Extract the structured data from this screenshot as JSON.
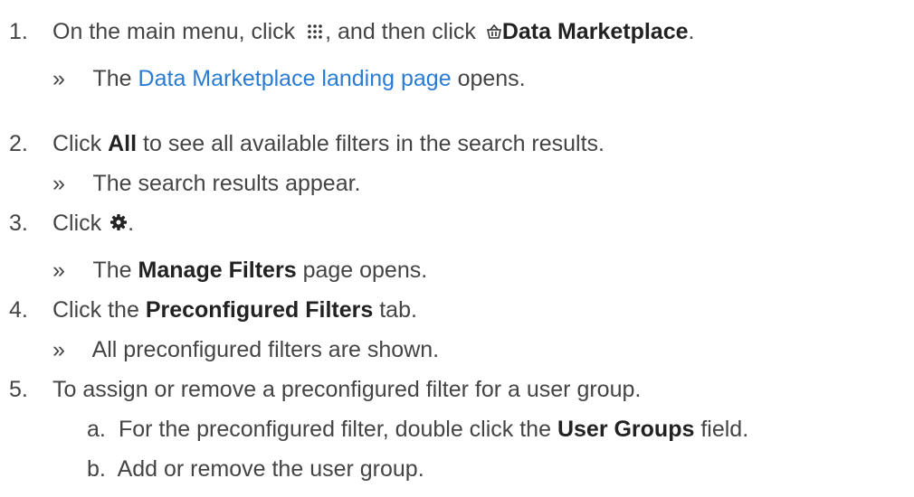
{
  "steps": [
    {
      "num": "1.",
      "text": {
        "a": "On the main menu, click",
        "b": ", and then click",
        "c": "Data Marketplace",
        "d": "."
      },
      "result": {
        "arrow": "»",
        "a": "The",
        "link": "Data Marketplace landing page",
        "b": "opens."
      }
    },
    {
      "num": "2.",
      "text": {
        "a": "Click",
        "bold": "All",
        "b": "to see all available filters in the search results."
      },
      "result": {
        "arrow": "»",
        "text": "The search results appear."
      }
    },
    {
      "num": "3.",
      "text": {
        "a": "Click",
        "b": "."
      },
      "result": {
        "arrow": "»",
        "a": "The",
        "bold": "Manage Filters",
        "b": "page opens."
      }
    },
    {
      "num": "4.",
      "text": {
        "a": "Click the",
        "bold": "Preconfigured Filters",
        "b": "tab."
      },
      "result": {
        "arrow": "»",
        "text": "All preconfigured filters are shown."
      }
    },
    {
      "num": "5.",
      "text": "To assign or remove a preconfigured filter for a user group.",
      "substeps": [
        {
          "label": "a.",
          "a": "For the preconfigured filter, double click the",
          "bold": "User Groups",
          "b": "field."
        },
        {
          "label": "b.",
          "text": "Add or remove the user group."
        }
      ]
    }
  ],
  "icons": {
    "menu": "grid-dots-icon",
    "marketplace": "basket-icon",
    "settings": "gear-icon"
  },
  "colors": {
    "text": "#444444",
    "link": "#2a7bd3"
  }
}
